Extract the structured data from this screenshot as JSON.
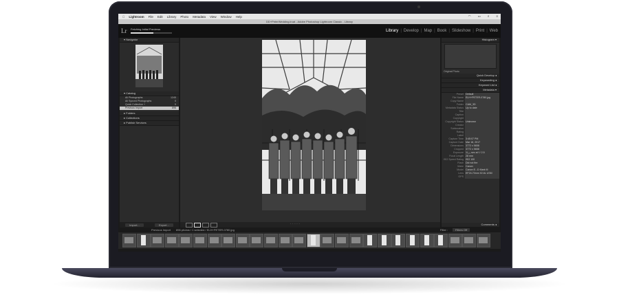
{
  "menubar": {
    "app": "Lightroom",
    "items": [
      "File",
      "Edit",
      "Library",
      "Photo",
      "Metadata",
      "View",
      "Window",
      "Help"
    ]
  },
  "window": {
    "title": "DD+PeterWedding.lrcat - Adobe Photoshop Lightroom Classic - Library"
  },
  "topbar": {
    "logo": "Lr",
    "progress_text": "Fetching Initial Previews",
    "progress_fraction": 0.55,
    "modules": [
      "Library",
      "Develop",
      "Map",
      "Book",
      "Slideshow",
      "Print",
      "Web"
    ],
    "active_module": "Library"
  },
  "left_panel": {
    "navigator_label": "Navigator",
    "catalog_label": "Catalog",
    "catalog_items": [
      {
        "label": "All Photographs",
        "count": "1245"
      },
      {
        "label": "All Synced Photographs",
        "count": "0"
      },
      {
        "label": "Quick Collection +",
        "count": "0"
      },
      {
        "label": "Previous Import",
        "count": "896"
      }
    ],
    "folders_label": "Folders",
    "collections_label": "Collections",
    "publish_label": "Publish Services",
    "import_label": "Import...",
    "export_label": "Export..."
  },
  "right_panel": {
    "histogram_label": "Histogram",
    "original_photo": "Original Photo",
    "quick_develop": "Quick Develop",
    "keywording": "Keywording",
    "keyword_list": "Keyword List",
    "metadata": "Metadata",
    "preset_label": "Default",
    "comments": "Comments",
    "rows": [
      {
        "k": "Preset",
        "v": "Default"
      },
      {
        "k": "File Name",
        "v": "ELH+PETER-0780.jpg"
      },
      {
        "k": "Copy Name",
        "v": ""
      },
      {
        "k": "Folder",
        "v": "CAM_3D"
      },
      {
        "k": "Metadata Status",
        "v": "Up to date"
      },
      {
        "k": "Title",
        "v": ""
      },
      {
        "k": "Caption",
        "v": ""
      },
      {
        "k": "Copyright",
        "v": ""
      },
      {
        "k": "Copyright Status",
        "v": "Unknown"
      },
      {
        "k": "Creator",
        "v": ""
      },
      {
        "k": "Sublocation",
        "v": ""
      },
      {
        "k": "Rating",
        "v": ""
      },
      {
        "k": "Label",
        "v": ""
      },
      {
        "k": "Capture Time",
        "v": "3:45:07 PM"
      },
      {
        "k": "Capture Date",
        "v": "Mar 18, 2017"
      },
      {
        "k": "Dimensions",
        "v": "3772 x 5658"
      },
      {
        "k": "Cropped",
        "v": "3772 x 5658"
      },
      {
        "k": "Exposure",
        "v": "1/₁₂₅ sec at f / 2.5"
      },
      {
        "k": "Focal Length",
        "v": "28 mm"
      },
      {
        "k": "ISO Speed Rating",
        "v": "ISO 100"
      },
      {
        "k": "Flash",
        "v": "Did not fire"
      },
      {
        "k": "Make",
        "v": "Canon"
      },
      {
        "k": "Model",
        "v": "Canon E...D Mark III"
      },
      {
        "k": "Lens",
        "v": "EF24-70mm f/2.8L USM"
      },
      {
        "k": "GPS",
        "v": ""
      }
    ]
  },
  "filmstrip": {
    "source": "Previous Import",
    "status": "896 photos / 1 selected / ELH+PETER-0780.jpg",
    "filter_label": "Filter :",
    "filter_value": "Filters Off",
    "thumbs": [
      {
        "kind": "landscape"
      },
      {
        "kind": "portrait"
      },
      {
        "kind": "landscape"
      },
      {
        "kind": "landscape"
      },
      {
        "kind": "landscape"
      },
      {
        "kind": "landscape"
      },
      {
        "kind": "landscape"
      },
      {
        "kind": "landscape"
      },
      {
        "kind": "landscape"
      },
      {
        "kind": "landscape"
      },
      {
        "kind": "landscape"
      },
      {
        "kind": "landscape"
      },
      {
        "kind": "landscape"
      },
      {
        "kind": "portrait",
        "selected": true
      },
      {
        "kind": "landscape"
      },
      {
        "kind": "landscape"
      },
      {
        "kind": "landscape"
      },
      {
        "kind": "portrait"
      },
      {
        "kind": "portrait"
      },
      {
        "kind": "portrait"
      },
      {
        "kind": "portrait"
      },
      {
        "kind": "portrait"
      },
      {
        "kind": "portrait"
      },
      {
        "kind": "landscape"
      },
      {
        "kind": "landscape"
      },
      {
        "kind": "landscape"
      }
    ]
  },
  "colors": {
    "panel": "#2b2b2b",
    "center": "#2d2d2d",
    "lid": "#1b1b22"
  }
}
